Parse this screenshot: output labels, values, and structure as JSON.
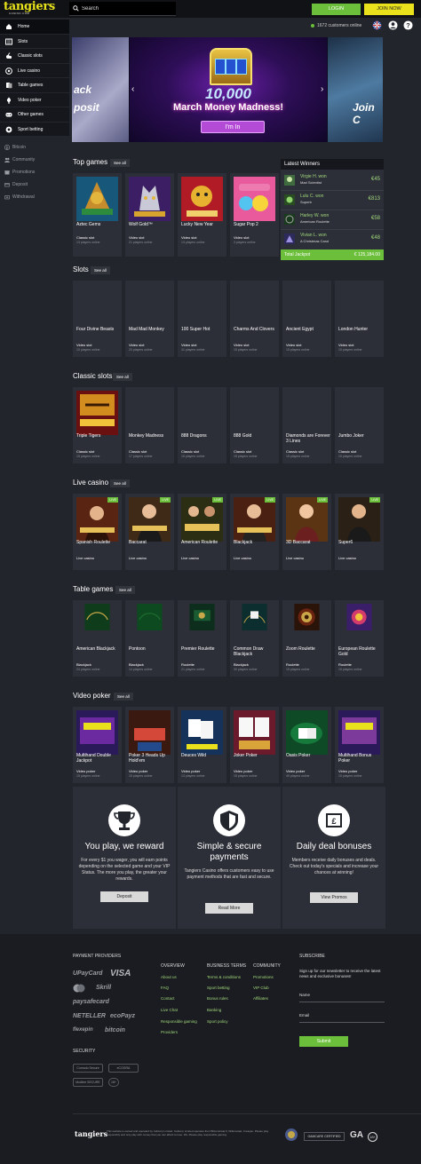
{
  "header": {
    "logo_word": "tangiers",
    "logo_sub": "CASINO.COM",
    "search_placeholder": "Search",
    "login_label": "LOGIN",
    "join_label": "JOIN NOW",
    "online_text": "1672 customers online",
    "colors": {
      "accent_green": "#6bbf3a",
      "accent_yellow": "#e8e11c",
      "background": "#23252d"
    }
  },
  "sidebar": {
    "items": [
      {
        "label": "Home",
        "icon": "home-icon"
      },
      {
        "label": "Slots",
        "icon": "slots-icon"
      },
      {
        "label": "Classic slots",
        "icon": "classic-slots-icon"
      },
      {
        "label": "Live casino",
        "icon": "live-casino-icon"
      },
      {
        "label": "Table games",
        "icon": "table-games-icon"
      },
      {
        "label": "Video poker",
        "icon": "video-poker-icon"
      },
      {
        "label": "Other games",
        "icon": "other-games-icon"
      },
      {
        "label": "Sport betting",
        "icon": "sport-betting-icon"
      }
    ],
    "sub_items": [
      {
        "label": "Bitcoin",
        "icon": "bitcoin-icon"
      },
      {
        "label": "Community",
        "icon": "community-icon"
      },
      {
        "label": "Promotions",
        "icon": "promotions-icon"
      },
      {
        "label": "Deposit",
        "icon": "deposit-icon"
      },
      {
        "label": "Withdrawal",
        "icon": "withdrawal-icon"
      }
    ]
  },
  "banner": {
    "left_text_1": "ack",
    "left_text_2": "posit",
    "amount": "10,000",
    "title": "March Money Madness!",
    "button": "I'm In",
    "right_text": "Join C"
  },
  "see_all": "See all",
  "sections": {
    "top": {
      "title": "Top games",
      "games": [
        {
          "name": "Aztec Gems",
          "type": "Classic slot",
          "players": "13 players online"
        },
        {
          "name": "Wolf Gold™",
          "type": "Video slot",
          "players": "21 players online"
        },
        {
          "name": "Lucky New Year",
          "type": "Video slot",
          "players": "13 players online"
        },
        {
          "name": "Sugar Pop 2",
          "type": "Video slot",
          "players": "3 players online"
        }
      ]
    },
    "slots": {
      "title": "Slots",
      "games": [
        {
          "name": "Four Divine Beasts",
          "type": "Video slot",
          "players": "10 players online"
        },
        {
          "name": "Mad Mad Monkey",
          "type": "Video slot",
          "players": "20 players online"
        },
        {
          "name": "100 Super Hot",
          "type": "Video slot",
          "players": "41 players online"
        },
        {
          "name": "Charms And Clovers",
          "type": "Video slot",
          "players": "15 players online"
        },
        {
          "name": "Ancient Egypt",
          "type": "Video slot",
          "players": "15 players online"
        },
        {
          "name": "London Hunter",
          "type": "Video slot",
          "players": "15 players online"
        }
      ]
    },
    "classic": {
      "title": "Classic slots",
      "games": [
        {
          "name": "Triple Tigers",
          "type": "Classic slot",
          "players": "15 players online"
        },
        {
          "name": "Monkey Madness",
          "type": "Classic slot",
          "players": "17 players online"
        },
        {
          "name": "888 Dragons",
          "type": "Classic slot",
          "players": "15 players online"
        },
        {
          "name": "888 Gold",
          "type": "Classic slot",
          "players": "15 players online"
        },
        {
          "name": "Diamonds are Forever 3 Lines",
          "type": "Classic slot",
          "players": "15 players online"
        },
        {
          "name": "Jumbo Joker",
          "type": "Classic slot",
          "players": "15 players online"
        }
      ]
    },
    "live": {
      "title": "Live casino",
      "games": [
        {
          "name": "Spanish Roulette",
          "type": "Live casino",
          "badge": "LIVE"
        },
        {
          "name": "Baccarat",
          "type": "Live casino",
          "badge": "LIVE"
        },
        {
          "name": "American Roulette",
          "type": "Live casino",
          "badge": "LIVE"
        },
        {
          "name": "Blackjack",
          "type": "Live casino",
          "badge": "LIVE"
        },
        {
          "name": "3D Baccarat",
          "type": "Live casino",
          "badge": "LIVE"
        },
        {
          "name": "Super6",
          "type": "Live casino",
          "badge": "LIVE"
        }
      ]
    },
    "table": {
      "title": "Table games",
      "games": [
        {
          "name": "American Blackjack",
          "type": "Blackjack",
          "players": "24 players online"
        },
        {
          "name": "Pontoon",
          "type": "Blackjack",
          "players": "14 players online"
        },
        {
          "name": "Premier Roulette",
          "type": "Roulette",
          "players": "21 players online"
        },
        {
          "name": "Common Draw Blackjack",
          "type": "Blackjack",
          "players": "30 players online"
        },
        {
          "name": "Zoom Roulette",
          "type": "Roulette",
          "players": "15 players online"
        },
        {
          "name": "European Roulette Gold",
          "type": "Roulette",
          "players": "15 players online"
        }
      ]
    },
    "poker": {
      "title": "Video poker",
      "games": [
        {
          "name": "Multihand Double Jackpot",
          "type": "Video poker",
          "players": "15 players online"
        },
        {
          "name": "Poker 3 Heads Up Hold'em",
          "type": "Video poker",
          "players": "15 players online"
        },
        {
          "name": "Deuces Wild",
          "type": "Video poker",
          "players": "13 players online"
        },
        {
          "name": "Joker Poker",
          "type": "Video poker",
          "players": "15 players online"
        },
        {
          "name": "Oasis Poker",
          "type": "Video poker",
          "players": "49 players online"
        },
        {
          "name": "Multihand Bonus Poker",
          "type": "Video poker",
          "players": "15 players online"
        }
      ]
    }
  },
  "winners": {
    "title": "Latest Winners",
    "rows": [
      {
        "who": "Virgie H. won",
        "game": "Mad Scientist",
        "amount": "€45"
      },
      {
        "who": "Lulu C. won",
        "game": "Superb",
        "amount": "€813"
      },
      {
        "who": "Harley W. won",
        "game": "American Roulette",
        "amount": "€58"
      },
      {
        "who": "Vivian L. won",
        "game": "A Christmas Carol",
        "amount": "€48"
      }
    ],
    "jackpot_label": "Total Jackpot",
    "jackpot_value": "€ 125,184.00"
  },
  "features": [
    {
      "title": "You play, we reward",
      "body": "For every $1 you wager, you will earn points depending on the selected game and your VIP Status. The more you play, the greater your rewards.",
      "button": "Deposit",
      "icon": "trophy-icon"
    },
    {
      "title": "Simple & secure payments",
      "body": "Tangiers Casino offers customers easy to use payment methods that are fast and secure.",
      "button": "Read More",
      "icon": "shield-icon"
    },
    {
      "title": "Daily deal bonuses",
      "body": "Members receive daily bonuses and deals. Check out today's specials and increase your chances at winning!",
      "button": "View Promos",
      "icon": "pound-note-icon"
    }
  ],
  "footer": {
    "payment_title": "PAYMENT PROVIDERS",
    "payment_logos": [
      "UPayCard",
      "VISA",
      "Skrill",
      "paysafecard",
      "NETELLER",
      "ecoPayz",
      "flexepin",
      "bitcoin"
    ],
    "security_title": "SECURITY",
    "security_logos": [
      "Comodo Secure",
      "eCOGRA",
      "McAfee SECURE",
      "18+"
    ],
    "overview_title": "OVERVIEW",
    "overview_links": [
      "About us",
      "FAQ",
      "Contact",
      "Live Chat",
      "Responsible gaming",
      "Providers"
    ],
    "business_title": "BUSINESS TERMS",
    "business_links": [
      "Terms & conditions",
      "Sport betting",
      "Bonus rules",
      "Banking",
      "Sport policy"
    ],
    "community_title": "COMMUNITY",
    "community_links": [
      "Promotions",
      "VIP Club",
      "Affiliates"
    ],
    "subscribe_title": "SUBSCRIBE",
    "subscribe_text": "Sign up for our newsletter to receive the latest news and exclusive bonuses!",
    "name_label": "Name",
    "email_label": "Email",
    "submit_label": "Submit",
    "legal_logo": "tangiers",
    "legal_text": "This website is owned and operated by Cellcorp Limited. Cellcorp Limited operates from Bilzenstraat 6, Willemstad, Curaçao. Please play responsibly and only play with money that you can afford to lose. 18+ Please play responsible gaming.",
    "bottom_logos": [
      "GAMCARE CERTIFIED",
      "GA",
      "18+"
    ]
  }
}
